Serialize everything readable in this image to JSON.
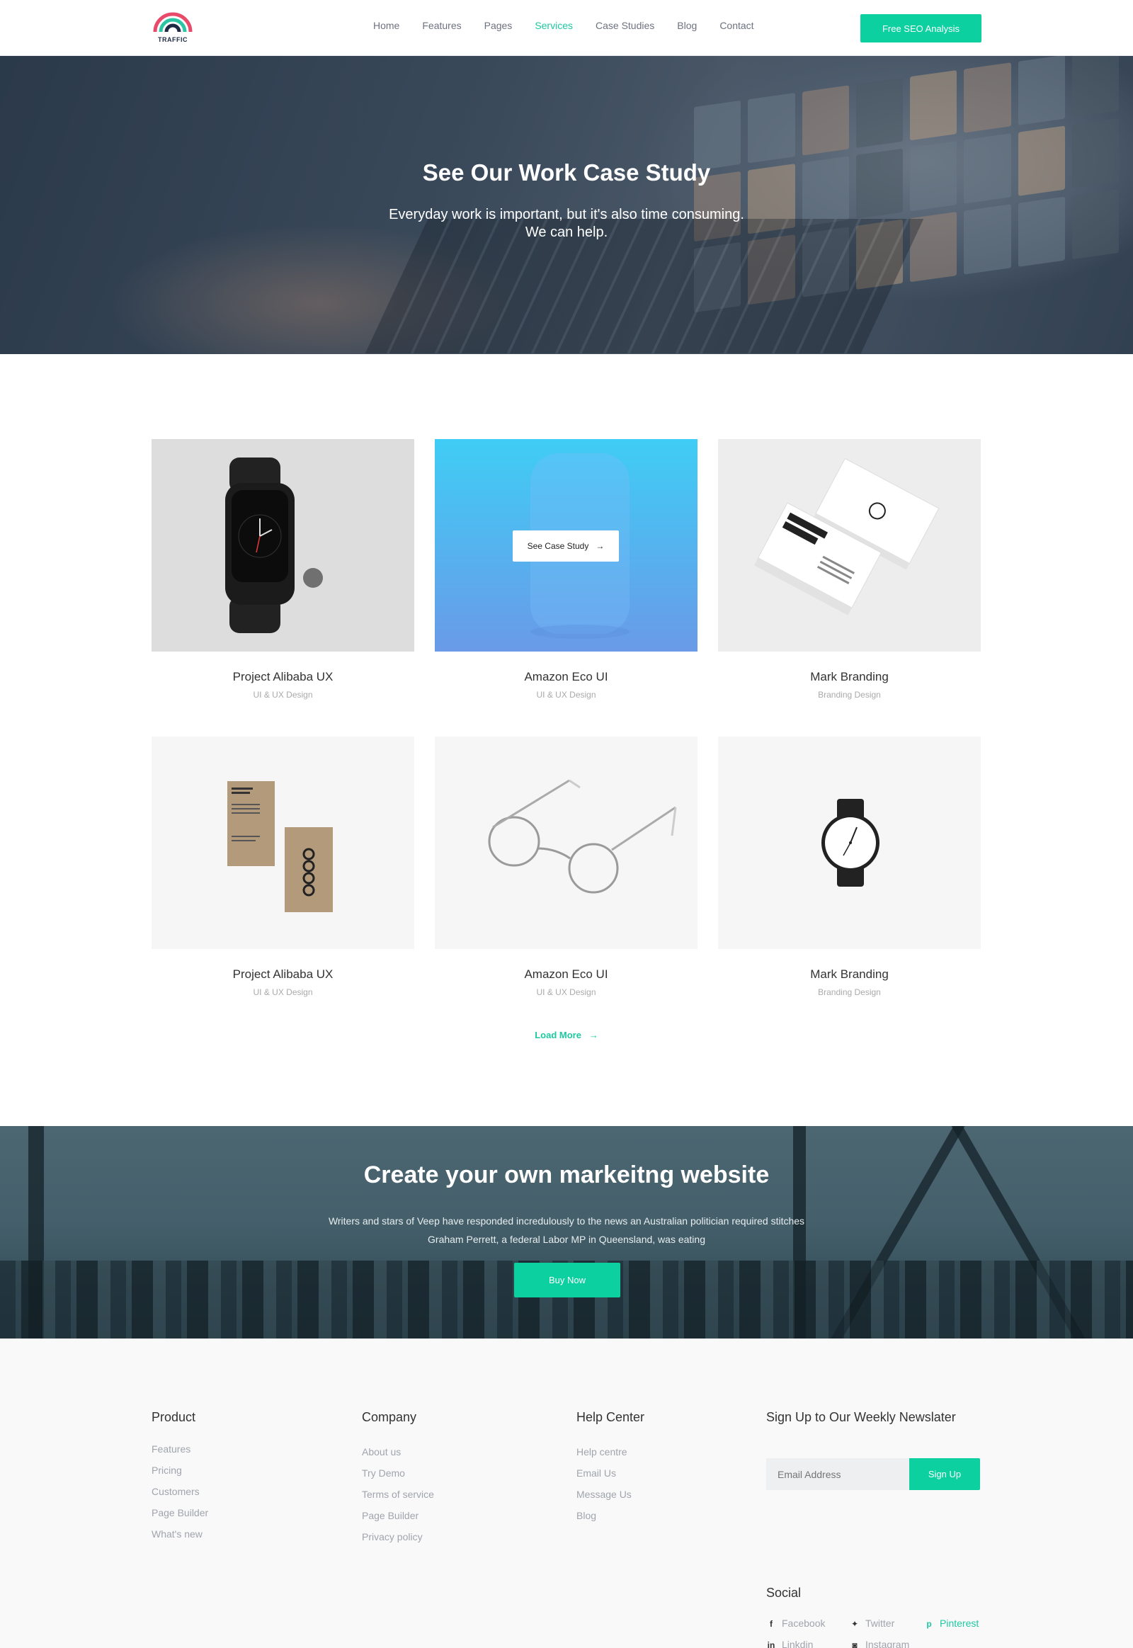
{
  "nav": {
    "logo_text": "TRAFFIC",
    "items": [
      "Home",
      "Features",
      "Pages",
      "Services",
      "Case Studies",
      "Blog",
      "Contact"
    ],
    "active_item": "Services",
    "cta_label": "Free SEO Analysis"
  },
  "hero": {
    "title": "See Our Work Case Study",
    "subtitle_line1": "Everyday work is important, but it's also time consuming.",
    "subtitle_line2": "We can help."
  },
  "projects": [
    {
      "title": "Project Alibaba UX",
      "category": "UI & UX Design",
      "image": "smartwatch"
    },
    {
      "title": "Amazon Eco UI",
      "category": "UI & UX Design",
      "image": "smart-speaker",
      "overlay_label": "See Case Study",
      "overlay_icon": "arrow-right-icon"
    },
    {
      "title": "Mark Branding",
      "category": "Branding Design",
      "image": "business-cards"
    },
    {
      "title": "Project Alibaba UX",
      "category": "UI & UX Design",
      "image": "kraft-cards"
    },
    {
      "title": "Amazon Eco UI",
      "category": "UI & UX Design",
      "image": "eyeglasses"
    },
    {
      "title": "Mark Branding",
      "category": "Branding Design",
      "image": "wristwatch"
    }
  ],
  "load_more_label": "Load More",
  "banner": {
    "title": "Create your own markeitng website",
    "text_line1": "Writers and stars of Veep have responded incredulously to the news an Australian politician required stitches",
    "text_line2": "Graham Perrett, a federal Labor MP in Queensland, was eating",
    "button_label": "Buy Now"
  },
  "footer": {
    "product": {
      "heading": "Product",
      "links": [
        "Features",
        "Pricing",
        "Customers",
        "Page Builder",
        "What's new"
      ]
    },
    "company": {
      "heading": "Company",
      "links": [
        "About us",
        "Try Demo",
        "Terms of service",
        "Page Builder",
        "Privacy policy"
      ]
    },
    "help": {
      "heading": "Help Center",
      "links": [
        "Help centre",
        "Email Us",
        "Message Us",
        "Blog"
      ]
    },
    "newsletter": {
      "heading": "Sign Up to Our Weekly Newslater",
      "placeholder": "Email Address",
      "button_label": "Sign Up"
    },
    "social": {
      "heading": "Social",
      "links": [
        {
          "label": "Facebook",
          "icon": "facebook-icon"
        },
        {
          "label": "Twitter",
          "icon": "twitter-icon"
        },
        {
          "label": "Pinterest",
          "icon": "pinterest-icon"
        },
        {
          "label": "Linkdin",
          "icon": "linkedin-icon"
        },
        {
          "label": "Instagram",
          "icon": "instagram-icon"
        }
      ]
    }
  },
  "colors": {
    "accent": "#0dd0a1",
    "text": "#333333",
    "muted": "#a0a4ac",
    "footer_bg": "#f9f9fa"
  }
}
